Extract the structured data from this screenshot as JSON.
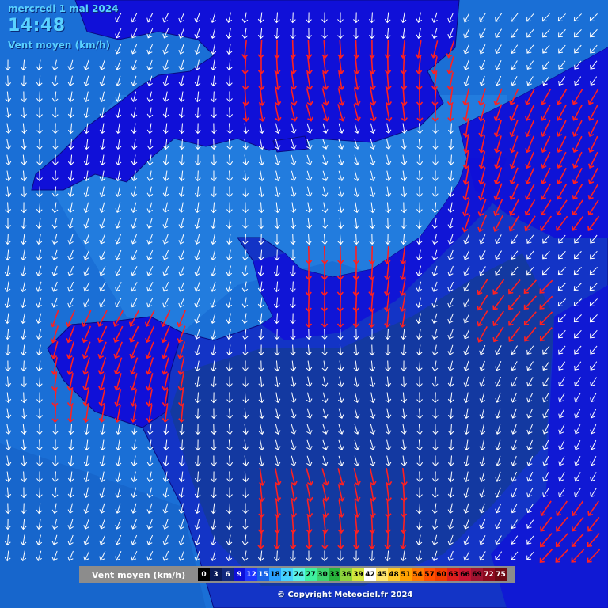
{
  "header": {
    "date": "mercredi 1 mai 2024",
    "time": "14:48",
    "variable": "Vent moyen (km/h)"
  },
  "legend": {
    "title": "Vent moyen (km/h)",
    "steps": [
      {
        "value": "0",
        "color": "#000000",
        "text_color": "#ffffff"
      },
      {
        "value": "3",
        "color": "#0a1a5a",
        "text_color": "#ffffff"
      },
      {
        "value": "6",
        "color": "#11287e",
        "text_color": "#ffffff"
      },
      {
        "value": "9",
        "color": "#0d10d8",
        "text_color": "#ffffff"
      },
      {
        "value": "12",
        "color": "#1e36ff",
        "text_color": "#ffffff"
      },
      {
        "value": "15",
        "color": "#1763e6",
        "text_color": "#ffffff"
      },
      {
        "value": "18",
        "color": "#2aa0ff",
        "text_color": "#000000"
      },
      {
        "value": "21",
        "color": "#46d2ff",
        "text_color": "#000000"
      },
      {
        "value": "24",
        "color": "#5af0e6",
        "text_color": "#000000"
      },
      {
        "value": "27",
        "color": "#3ef0a0",
        "text_color": "#000000"
      },
      {
        "value": "30",
        "color": "#3ed26e",
        "text_color": "#000000"
      },
      {
        "value": "33",
        "color": "#28b43c",
        "text_color": "#000000"
      },
      {
        "value": "36",
        "color": "#8cd23c",
        "text_color": "#000000"
      },
      {
        "value": "39",
        "color": "#d2e63c",
        "text_color": "#000000"
      },
      {
        "value": "42",
        "color": "#ffffff",
        "text_color": "#000000"
      },
      {
        "value": "45",
        "color": "#ffe66e",
        "text_color": "#000000"
      },
      {
        "value": "48",
        "color": "#ffc828",
        "text_color": "#000000"
      },
      {
        "value": "51",
        "color": "#ffa000",
        "text_color": "#000000"
      },
      {
        "value": "54",
        "color": "#ff7800",
        "text_color": "#000000"
      },
      {
        "value": "57",
        "color": "#ff5000",
        "text_color": "#000000"
      },
      {
        "value": "60",
        "color": "#f03c00",
        "text_color": "#000000"
      },
      {
        "value": "63",
        "color": "#dc1e1e",
        "text_color": "#000000"
      },
      {
        "value": "66",
        "color": "#c81432",
        "text_color": "#000000"
      },
      {
        "value": "69",
        "color": "#a01432",
        "text_color": "#000000"
      },
      {
        "value": "72",
        "color": "#8c0a1e",
        "text_color": "#ffffff"
      },
      {
        "value": "75",
        "color": "#6e0a14",
        "text_color": "#ffffff"
      }
    ]
  },
  "copyright": "© Copyright Meteociel.fr 2024",
  "colors": {
    "sea": "#1a6fd6",
    "land_strong": "#1010d8",
    "land_mid": "#1334c6",
    "land_weak": "#143b9a",
    "arrow_normal": "#ffffff",
    "arrow_strong": "#ff2020"
  }
}
